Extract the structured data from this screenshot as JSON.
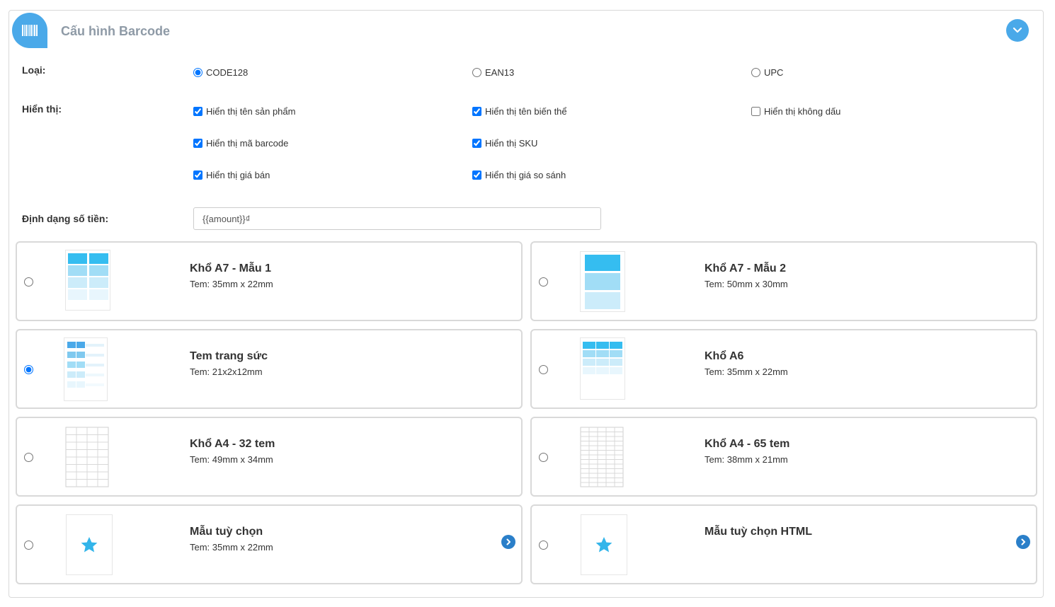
{
  "header": {
    "title": "Cấu hình Barcode",
    "icon": "barcode-icon",
    "collapse_icon": "chevron-down-icon"
  },
  "type": {
    "label": "Loại:",
    "options": [
      {
        "label": "CODE128",
        "checked": true
      },
      {
        "label": "EAN13",
        "checked": false
      },
      {
        "label": "UPC",
        "checked": false
      }
    ]
  },
  "display": {
    "label": "Hiển thị:",
    "options": [
      {
        "label": "Hiển thị tên sản phẩm",
        "checked": true
      },
      {
        "label": "Hiển thị tên biến thể",
        "checked": true
      },
      {
        "label": "Hiển thị không dấu",
        "checked": false
      },
      {
        "label": "Hiển thị mã barcode",
        "checked": true
      },
      {
        "label": "Hiển thị SKU",
        "checked": true
      },
      {
        "label": "Hiển thị giá bán",
        "checked": true
      },
      {
        "label": "Hiển thị giá so sánh",
        "checked": true
      }
    ]
  },
  "amount_format": {
    "label": "Định dạng số tiền:",
    "value": "{{amount}}₫"
  },
  "templates": [
    {
      "title": "Khổ A7 - Mẫu 1",
      "size": "Tem: 35mm x 22mm",
      "selected": false,
      "thumb": "a7-template-1-thumbnail"
    },
    {
      "title": "Khổ A7 - Mẫu 2",
      "size": "Tem: 50mm x 30mm",
      "selected": false,
      "thumb": "a7-template-2-thumbnail"
    },
    {
      "title": "Tem trang sức",
      "size": "Tem: 21x2x12mm",
      "selected": true,
      "thumb": "jewelry-label-thumbnail"
    },
    {
      "title": "Khổ A6",
      "size": "Tem: 35mm x 22mm",
      "selected": false,
      "thumb": "a6-thumbnail"
    },
    {
      "title": "Khổ A4 - 32 tem",
      "size": "Tem: 49mm x 34mm",
      "selected": false,
      "thumb": "a4-grid-thumbnail"
    },
    {
      "title": "Khổ A4 - 65 tem",
      "size": "Tem: 38mm x 21mm",
      "selected": false,
      "thumb": "a4-grid-thumbnail"
    },
    {
      "title": "Mẫu tuỳ chọn",
      "size": "Tem: 35mm x 22mm",
      "selected": false,
      "thumb": "star-icon",
      "arrow_icon": "chevron-right-circle-icon"
    },
    {
      "title": "Mẫu tuỳ chọn HTML",
      "size": "",
      "selected": false,
      "thumb": "star-icon",
      "arrow_icon": "chevron-right-circle-icon"
    }
  ],
  "colors": {
    "accent": "#4aa9e9",
    "cell_dark": "#35bdf0",
    "cell_mid": "#a1ddf6",
    "cell_light": "#ccecfa",
    "cell_pale": "#e8f6fd",
    "star": "#33b5ea"
  }
}
